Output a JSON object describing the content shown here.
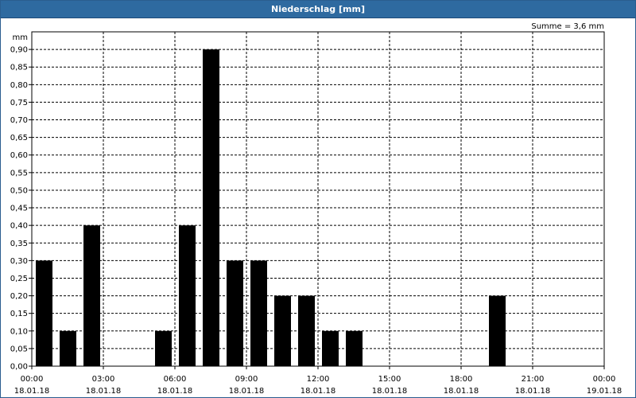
{
  "window": {
    "title": "Niederschlag [mm]"
  },
  "chart_data": {
    "type": "bar",
    "title": "Niederschlag [mm]",
    "yunit": "mm",
    "annotation": "Summe = 3,6 mm",
    "ylim": [
      0,
      0.95
    ],
    "yticks": [
      "0,00",
      "0,05",
      "0,10",
      "0,15",
      "0,20",
      "0,25",
      "0,30",
      "0,35",
      "0,40",
      "0,45",
      "0,50",
      "0,55",
      "0,60",
      "0,65",
      "0,70",
      "0,75",
      "0,80",
      "0,85",
      "0,90"
    ],
    "xlim_hours": [
      0,
      24
    ],
    "xticks": [
      {
        "time": "00:00",
        "date": "18.01.18"
      },
      {
        "time": "03:00",
        "date": "18.01.18"
      },
      {
        "time": "06:00",
        "date": "18.01.18"
      },
      {
        "time": "09:00",
        "date": "18.01.18"
      },
      {
        "time": "12:00",
        "date": "18.01.18"
      },
      {
        "time": "15:00",
        "date": "18.01.18"
      },
      {
        "time": "18:00",
        "date": "18.01.18"
      },
      {
        "time": "21:00",
        "date": "18.01.18"
      },
      {
        "time": "00:00",
        "date": "19.01.18"
      }
    ],
    "categories": [
      "01:00",
      "02:00",
      "03:00",
      "06:00",
      "07:00",
      "08:00",
      "09:00",
      "10:00",
      "11:00",
      "12:00",
      "13:00",
      "14:00",
      "20:00"
    ],
    "values": [
      0.3,
      0.1,
      0.4,
      0.1,
      0.4,
      0.9,
      0.3,
      0.3,
      0.2,
      0.2,
      0.1,
      0.1,
      0.2
    ],
    "grid": true,
    "bar_color": "#000000"
  }
}
